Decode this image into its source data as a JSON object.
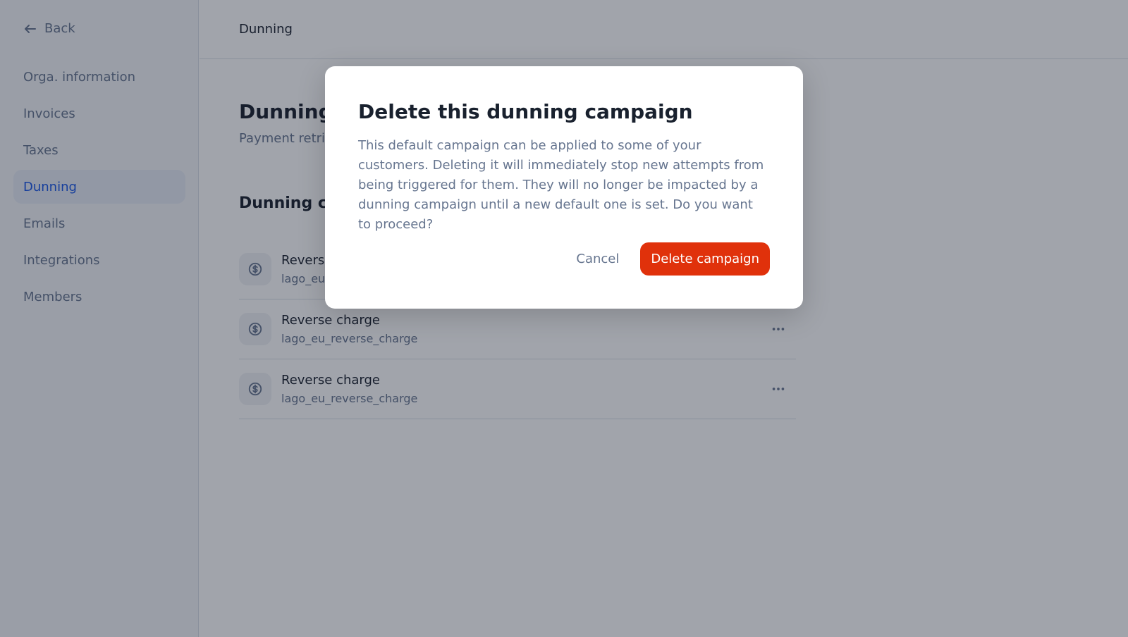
{
  "sidebar": {
    "back_label": "Back",
    "items": [
      {
        "label": "Orga. information",
        "active": false
      },
      {
        "label": "Invoices",
        "active": false
      },
      {
        "label": "Taxes",
        "active": false
      },
      {
        "label": "Dunning",
        "active": true
      },
      {
        "label": "Emails",
        "active": false
      },
      {
        "label": "Integrations",
        "active": false
      },
      {
        "label": "Members",
        "active": false
      }
    ]
  },
  "header": {
    "title": "Dunning"
  },
  "page": {
    "title": "Dunning",
    "subtitle": "Payment retrie",
    "section_title": "Dunning ca"
  },
  "campaigns": [
    {
      "title": "Reverse charge",
      "code": "lago_eu_reverse_charge"
    },
    {
      "title": "Reverse charge",
      "code": "lago_eu_reverse_charge"
    },
    {
      "title": "Reverse charge",
      "code": "lago_eu_reverse_charge"
    }
  ],
  "modal": {
    "title": "Delete this dunning campaign",
    "body": "This default campaign can be applied to some of your customers. Deleting it will immediately stop new attempts from being triggered for them. They will no longer be impacted by a dunning campaign until a new default one is set. Do you want to proceed?",
    "cancel_label": "Cancel",
    "confirm_label": "Delete campaign"
  },
  "colors": {
    "accent": "#1a57e6",
    "danger": "#e0310b",
    "muted_text": "#66758f"
  }
}
